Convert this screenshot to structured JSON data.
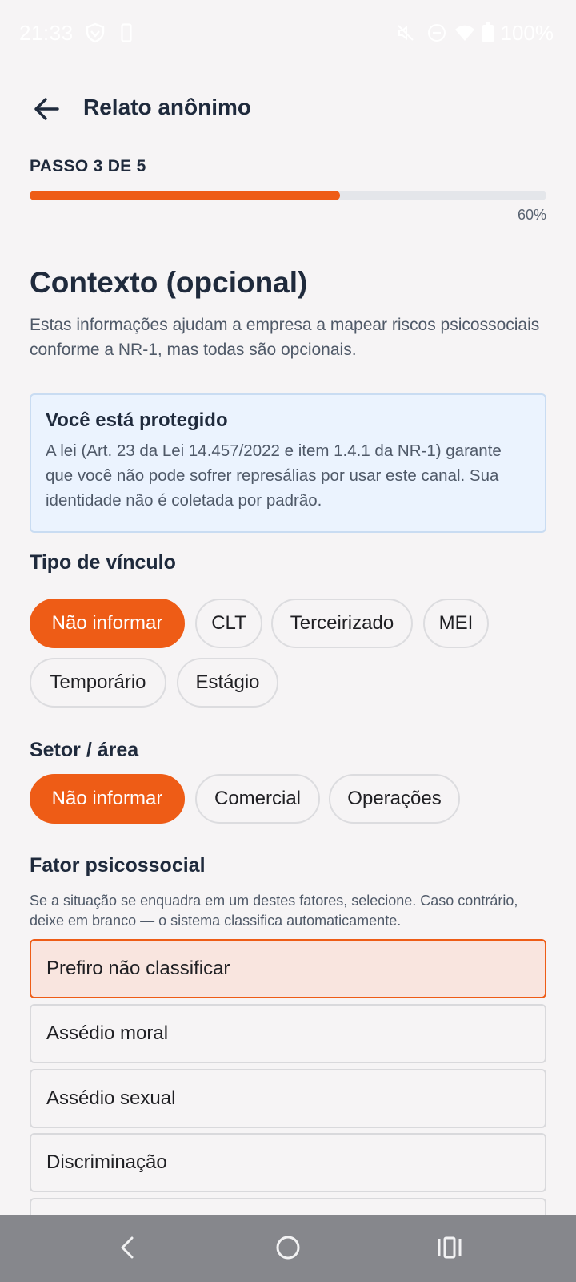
{
  "status_bar": {
    "time": "21:33",
    "battery": "100%",
    "icons": [
      "shield-icon",
      "phone-icon",
      "mute-icon",
      "dnd-icon",
      "wifi-icon",
      "battery-icon"
    ]
  },
  "header": {
    "back_icon": "arrow-left-icon",
    "title": "Relato anônimo"
  },
  "progress": {
    "step_label": "PASSO 3 DE 5",
    "percent_label": "60%",
    "fraction": 0.6
  },
  "section": {
    "title": "Contexto (opcional)",
    "description": "Estas informações ajudam a empresa a mapear riscos psicossociais conforme a NR-1, mas todas são opcionais."
  },
  "info": {
    "title": "Você está protegido",
    "text": "A lei (Art. 23 da Lei 14.457/2022 e item 1.4.1 da NR-1) garante que você não pode sofrer represálias por usar este canal. Sua identidade não é coletada por padrão."
  },
  "vinculo": {
    "label": "Tipo de vínculo",
    "options": [
      "Não informar",
      "CLT",
      "Terceirizado",
      "MEI",
      "Temporário",
      "Estágio"
    ],
    "selected": "Não informar"
  },
  "setor": {
    "label": "Setor / área",
    "options": [
      "Não informar",
      "Comercial",
      "Operações"
    ],
    "selected": "Não informar"
  },
  "fator": {
    "label": "Fator psicossocial",
    "help": "Se a situação se enquadra em um destes fatores, selecione. Caso contrário, deixe em branco — o sistema classifica automaticamente.",
    "options": [
      "Prefiro não classificar",
      "Assédio moral",
      "Assédio sexual",
      "Discriminação"
    ],
    "selected": "Prefiro não classificar"
  },
  "colors": {
    "accent": "#ee5c16",
    "info_bg": "#ebf3fe",
    "selected_row_bg": "#f9e5df"
  },
  "nav_bar": {
    "icons": [
      "back-nav-icon",
      "home-nav-icon",
      "recents-nav-icon"
    ]
  }
}
